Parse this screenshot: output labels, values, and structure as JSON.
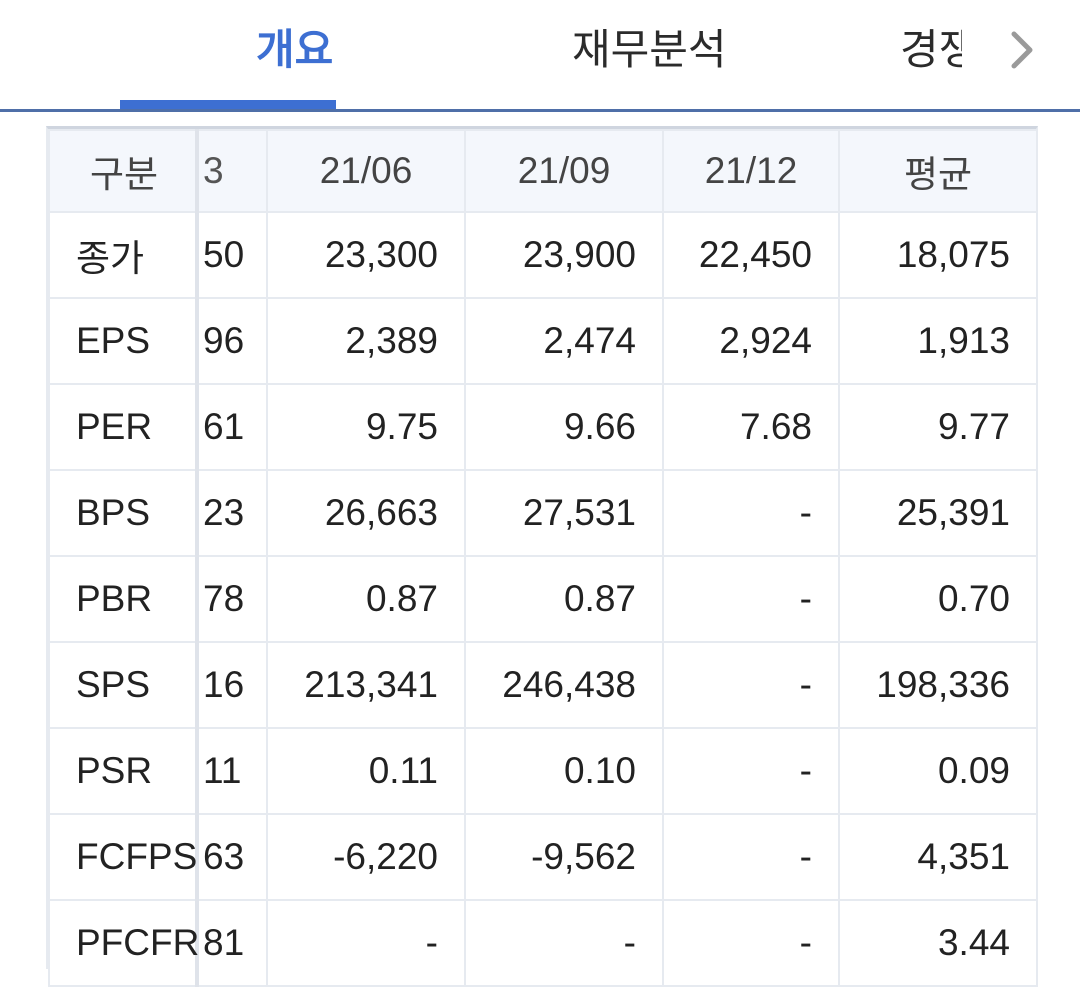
{
  "tabs": [
    {
      "label": "개요",
      "active": true
    },
    {
      "label": "재무분석",
      "active": false
    },
    {
      "label": "경쟁사비교",
      "active": false
    }
  ],
  "icons": {
    "next": "chevron-right-icon"
  },
  "colors": {
    "accent": "#3d6fd2",
    "header_bg": "#f4f7fc",
    "border": "#e6eaf0"
  },
  "table": {
    "headers": [
      "구분",
      "3",
      "21/06",
      "21/09",
      "21/12",
      "평균"
    ],
    "rows": [
      {
        "label": "종가",
        "partial": "50",
        "v2106": "23,300",
        "v2109": "23,900",
        "v2112": "22,450",
        "avg": "18,075"
      },
      {
        "label": "EPS",
        "partial": "96",
        "v2106": "2,389",
        "v2109": "2,474",
        "v2112": "2,924",
        "avg": "1,913"
      },
      {
        "label": "PER",
        "partial": "61",
        "v2106": "9.75",
        "v2109": "9.66",
        "v2112": "7.68",
        "avg": "9.77"
      },
      {
        "label": "BPS",
        "partial": "23",
        "v2106": "26,663",
        "v2109": "27,531",
        "v2112": "-",
        "avg": "25,391"
      },
      {
        "label": "PBR",
        "partial": "78",
        "v2106": "0.87",
        "v2109": "0.87",
        "v2112": "-",
        "avg": "0.70"
      },
      {
        "label": "SPS",
        "partial": "16",
        "v2106": "213,341",
        "v2109": "246,438",
        "v2112": "-",
        "avg": "198,336"
      },
      {
        "label": "PSR",
        "partial": "11",
        "v2106": "0.11",
        "v2109": "0.10",
        "v2112": "-",
        "avg": "0.09"
      },
      {
        "label": "FCFPS",
        "partial": "63",
        "v2106": "-6,220",
        "v2109": "-9,562",
        "v2112": "-",
        "avg": "4,351"
      },
      {
        "label": "PFCFR",
        "partial": "81",
        "v2106": "-",
        "v2109": "-",
        "v2112": "-",
        "avg": "3.44"
      }
    ]
  }
}
